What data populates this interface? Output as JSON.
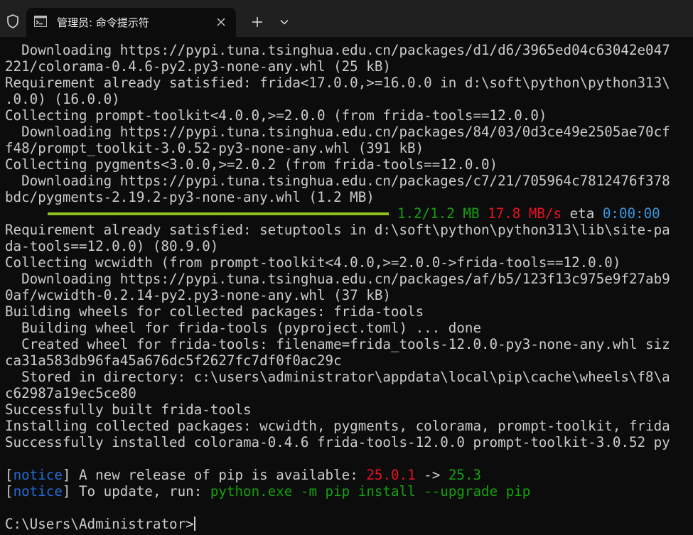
{
  "titlebar": {
    "tab_title": "管理员: 命令提示符",
    "icons": {
      "shield": "shield-icon",
      "tab": "cmd-icon",
      "close": "close-icon",
      "new_tab": "plus-icon",
      "dropdown": "chevron-down-icon"
    }
  },
  "colors": {
    "background": "#0c0c0c",
    "titlebar": "#202020",
    "text": "#cccccc",
    "notice": "#1f6cd6",
    "version_old": "#e81123",
    "version_new": "#13a10e",
    "speed": "#e81123",
    "eta": "#3a96dd",
    "progress": "#8cc21a"
  },
  "terminal": {
    "lines": [
      "  Downloading https://pypi.tuna.tsinghua.edu.cn/packages/d1/d6/3965ed04c63042e047",
      "221/colorama-0.4.6-py2.py3-none-any.whl (25 kB)",
      "Requirement already satisfied: frida<17.0.0,>=16.0.0 in d:\\soft\\python\\python313\\",
      ".0.0) (16.0.0)",
      "Collecting prompt-toolkit<4.0.0,>=2.0.0 (from frida-tools==12.0.0)",
      "  Downloading https://pypi.tuna.tsinghua.edu.cn/packages/84/03/0d3ce49e2505ae70cf",
      "f48/prompt_toolkit-3.0.52-py3-none-any.whl (391 kB)",
      "Collecting pygments<3.0.0,>=2.0.2 (from frida-tools==12.0.0)",
      "  Downloading https://pypi.tuna.tsinghua.edu.cn/packages/c7/21/705964c7812476f378",
      "bdc/pygments-2.19.2-py3-none-any.whl (1.2 MB)"
    ],
    "progress": {
      "fraction": 1.0,
      "size": "1.2/1.2 MB",
      "speed": "17.8 MB/s",
      "eta_label": "eta",
      "eta": "0:00:00"
    },
    "lines2": [
      "Requirement already satisfied: setuptools in d:\\soft\\python\\python313\\lib\\site-pa",
      "da-tools==12.0.0) (80.9.0)",
      "Collecting wcwidth (from prompt-toolkit<4.0.0,>=2.0.0->frida-tools==12.0.0)",
      "  Downloading https://pypi.tuna.tsinghua.edu.cn/packages/af/b5/123f13c975e9f27ab9",
      "0af/wcwidth-0.2.14-py2.py3-none-any.whl (37 kB)",
      "Building wheels for collected packages: frida-tools",
      "  Building wheel for frida-tools (pyproject.toml) ... done",
      "  Created wheel for frida-tools: filename=frida_tools-12.0.0-py3-none-any.whl siz",
      "ca31a583db96fa45a676dc5f2627fc7df0f0ac29c",
      "  Stored in directory: c:\\users\\administrator\\appdata\\local\\pip\\cache\\wheels\\f8\\a",
      "c62987a19ec5ce80",
      "Successfully built frida-tools",
      "Installing collected packages: wcwidth, pygments, colorama, prompt-toolkit, frida",
      "Successfully installed colorama-0.4.6 frida-tools-12.0.0 prompt-toolkit-3.0.52 py"
    ],
    "notice1": {
      "bracket_open": "[",
      "tag": "notice",
      "bracket_close": "]",
      "text": " A new release of pip is available: ",
      "old_version": "25.0.1",
      "arrow": " -> ",
      "new_version": "25.3"
    },
    "notice2": {
      "bracket_open": "[",
      "tag": "notice",
      "bracket_close": "]",
      "text": " To update, run: ",
      "command": "python.exe -m pip install --upgrade pip"
    },
    "prompt": "C:\\Users\\Administrator>"
  }
}
